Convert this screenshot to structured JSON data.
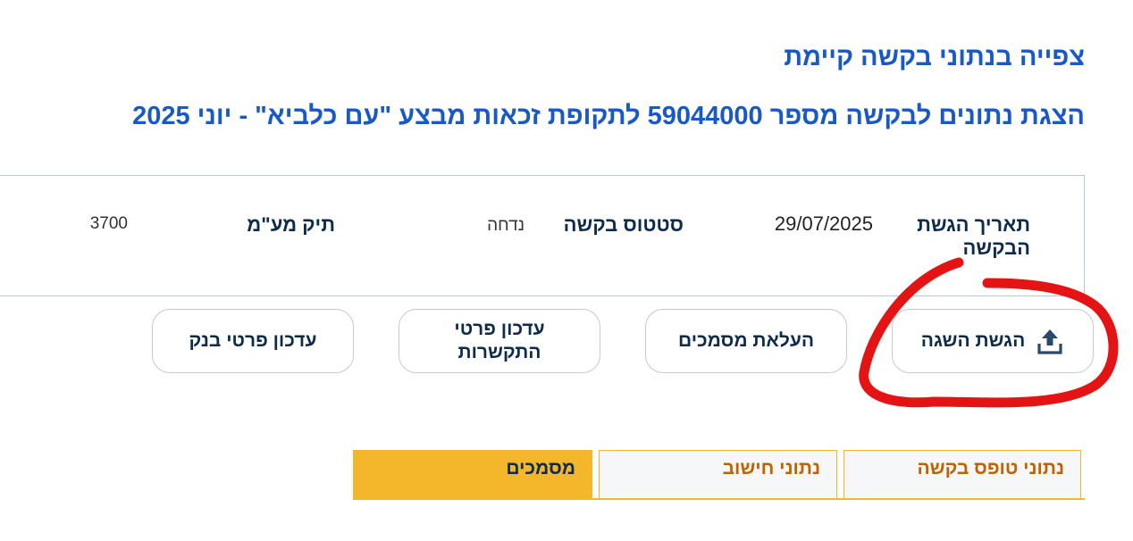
{
  "header": {
    "title": "צפייה בנתוני בקשה קיימת",
    "subtitle": "הצגת נתונים לבקשה מספר 59044000 לתקופת זכאות מבצע \"עם כלביא\" - יוני 2025"
  },
  "info": {
    "submission_date_label": "תאריך הגשת הבקשה",
    "submission_date_value": "29/07/2025",
    "status_label": "סטטוס בקשה",
    "status_value": "נדחה",
    "vat_file_label": "תיק מע\"מ",
    "vat_file_value": "3700"
  },
  "actions": {
    "submit_objection": "הגשת השגה",
    "upload_documents": "העלאת מסמכים",
    "update_contact": "עדכון פרטי התקשרות",
    "update_bank": "עדכון פרטי בנק"
  },
  "tabs": [
    {
      "label": "נתוני טופס בקשה",
      "active": false
    },
    {
      "label": "נתוני חישוב",
      "active": false
    },
    {
      "label": "מסמכים",
      "active": true
    }
  ],
  "colors": {
    "title_blue": "#1859c7",
    "navy_text": "#0d2b4a",
    "tab_accent": "#f4b62a",
    "tab_text_orange": "#c26100",
    "annotation_red": "#e41414"
  },
  "icons": {
    "objection_button_icon": "upload-icon",
    "annotation": "red-highlight-circle"
  }
}
